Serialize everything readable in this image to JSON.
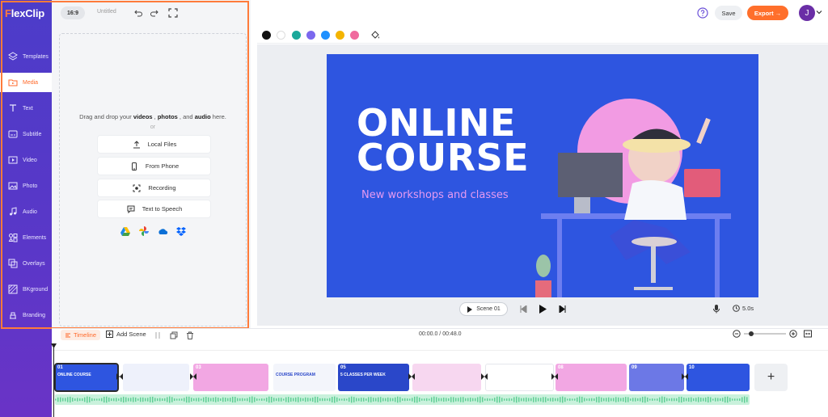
{
  "app": {
    "logo_f": "F",
    "logo_rest": "lexClip"
  },
  "sidebar": {
    "items": [
      {
        "label": "Templates",
        "icon": "layers-icon"
      },
      {
        "label": "Media",
        "icon": "folder-icon",
        "active": true
      },
      {
        "label": "Text",
        "icon": "text-icon"
      },
      {
        "label": "Subtitle",
        "icon": "subtitle-icon"
      },
      {
        "label": "Video",
        "icon": "video-icon"
      },
      {
        "label": "Photo",
        "icon": "photo-icon"
      },
      {
        "label": "Audio",
        "icon": "music-icon"
      },
      {
        "label": "Elements",
        "icon": "elements-icon"
      },
      {
        "label": "Overlays",
        "icon": "overlays-icon"
      },
      {
        "label": "BKground",
        "icon": "background-icon"
      },
      {
        "label": "Branding",
        "icon": "branding-icon"
      }
    ]
  },
  "toolbar": {
    "aspect_ratio": "16:9",
    "project_name": "Untitled",
    "save_label": "Save",
    "export_label": "Export →",
    "avatar_initial": "J"
  },
  "media": {
    "drop_prefix": "Drag and drop your ",
    "drop_videos": "videos",
    "drop_sep1": " , ",
    "drop_photos": "photos",
    "drop_sep2": " , and ",
    "drop_audio": "audio",
    "drop_suffix": " here.",
    "or_text": "or",
    "buttons": [
      {
        "label": "Local Files",
        "icon": "upload-icon"
      },
      {
        "label": "From Phone",
        "icon": "phone-icon"
      },
      {
        "label": "Recording",
        "icon": "record-icon"
      },
      {
        "label": "Text to Speech",
        "icon": "speech-icon"
      }
    ],
    "cloud_sources": [
      "google-drive-icon",
      "google-photos-icon",
      "onedrive-icon",
      "dropbox-icon"
    ]
  },
  "colors": {
    "swatches": [
      "#111111",
      "#ffffff",
      "#1aa89a",
      "#7b68ee",
      "#1e90ff",
      "#f4b400",
      "#f06a9e"
    ],
    "accent": "#ff6f2b",
    "brand": "#4c3cc9"
  },
  "slide": {
    "title_line1": "ONLINE",
    "title_line2": "COURSE",
    "subtitle": "New workshops and classes"
  },
  "player": {
    "scene_label": "Scene 01",
    "duration": "5.0s"
  },
  "timeline": {
    "tab_label": "Timeline",
    "add_scene_label": "Add Scene",
    "time": "00:00.0 / 00:48.0",
    "add_button": "+",
    "scenes": [
      {
        "num": "01",
        "text": "ONLINE COURSE",
        "bg": "#2e55e0"
      },
      {
        "num": "",
        "text": "",
        "bg": "#eef1fb"
      },
      {
        "num": "03",
        "text": "",
        "bg": "#f2a7e3"
      },
      {
        "num": "",
        "text": "COURSE PROGRAM",
        "bg": "#f3f5fb"
      },
      {
        "num": "05",
        "text": "5 CLASSES PER WEEK",
        "bg": "#2a47c9"
      },
      {
        "num": "",
        "text": "",
        "bg": "#f7d7f0"
      },
      {
        "num": "",
        "text": "",
        "bg": "#ffffff"
      },
      {
        "num": "08",
        "text": "",
        "bg": "#f2a7e3"
      },
      {
        "num": "09",
        "text": "",
        "bg": "#6c78e6"
      },
      {
        "num": "10",
        "text": "",
        "bg": "#2e55e0"
      }
    ]
  }
}
